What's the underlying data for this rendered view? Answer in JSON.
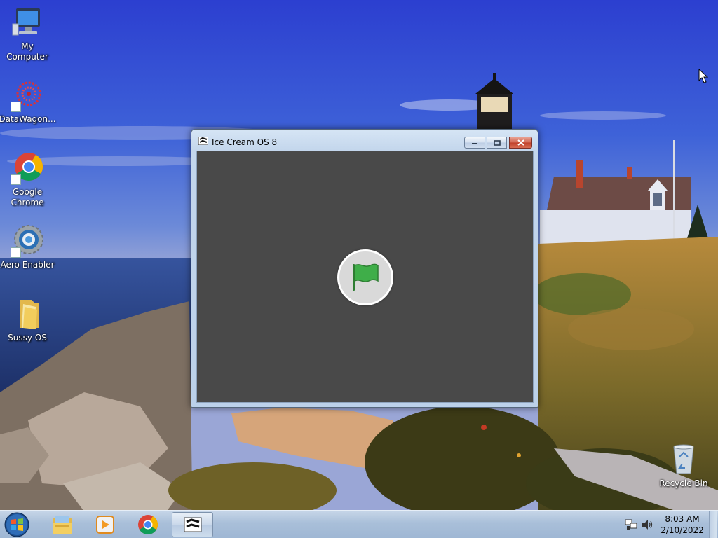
{
  "desktop": {
    "icons": [
      {
        "label": "My Computer",
        "icon": "computer-icon"
      },
      {
        "label": "DataWagon...",
        "icon": "datawagon-icon"
      },
      {
        "label": "Google Chrome",
        "icon": "chrome-icon"
      },
      {
        "label": "Aero Enabler",
        "icon": "gear-icon"
      },
      {
        "label": "Sussy OS",
        "icon": "folder-icon"
      },
      {
        "label": "Recycle Bin",
        "icon": "recycle-bin-icon"
      }
    ]
  },
  "window": {
    "title": "Ice Cream OS 8",
    "content_background": "#494949",
    "start_flag_color": "#3fae49",
    "buttons": [
      "minimize",
      "maximize",
      "close"
    ]
  },
  "taskbar": {
    "pinned": [
      "start-orb-icon",
      "file-explorer-icon",
      "media-player-icon",
      "chrome-icon",
      "ice-cream-os-icon"
    ],
    "clock": {
      "time": "8:03 AM",
      "date": "2/10/2022"
    },
    "tray": [
      "network-icon",
      "volume-icon"
    ]
  },
  "colors": {
    "taskbar": "#a9bfd9",
    "window_frame": "#c3d6ec",
    "close_button": "#c0402a"
  }
}
